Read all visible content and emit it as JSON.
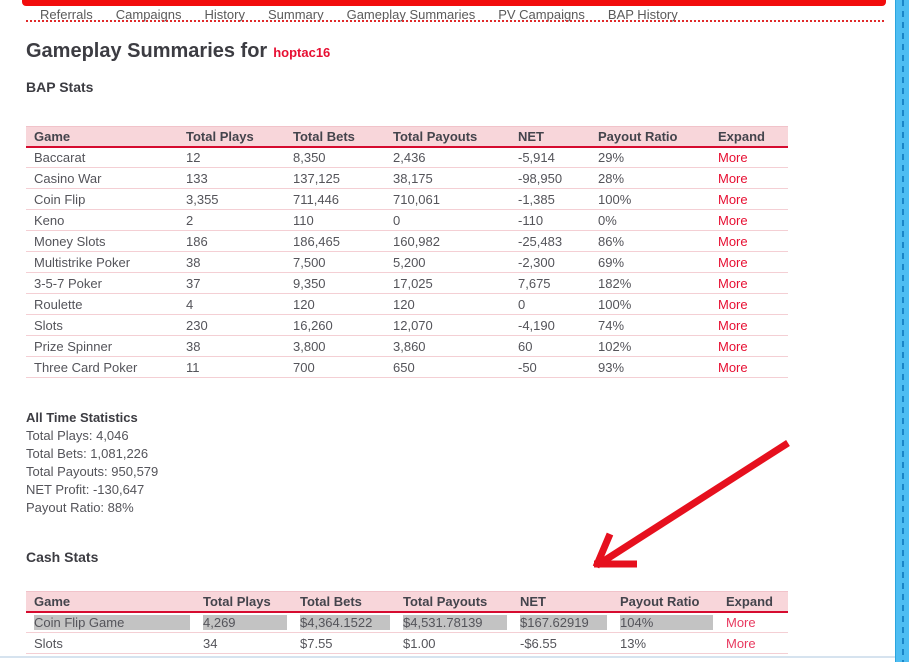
{
  "nav": {
    "items": [
      "Referrals",
      "Campaigns",
      "History",
      "Summary",
      "Gameplay Summaries",
      "PV Campaigns",
      "BAP History"
    ]
  },
  "page": {
    "title": "Gameplay Summaries for",
    "username": "hoptac16"
  },
  "bap": {
    "heading": "BAP Stats",
    "table": {
      "headers": [
        "Game",
        "Total Plays",
        "Total Bets",
        "Total Payouts",
        "NET",
        "Payout Ratio",
        "Expand"
      ],
      "rows": [
        {
          "cells": [
            "Baccarat",
            "12",
            "8,350",
            "2,436",
            "-5,914",
            "29%"
          ],
          "expand": "More"
        },
        {
          "cells": [
            "Casino War",
            "133",
            "137,125",
            "38,175",
            "-98,950",
            "28%"
          ],
          "expand": "More"
        },
        {
          "cells": [
            "Coin Flip",
            "3,355",
            "711,446",
            "710,061",
            "-1,385",
            "100%"
          ],
          "expand": "More"
        },
        {
          "cells": [
            "Keno",
            "2",
            "110",
            "0",
            "-110",
            "0%"
          ],
          "expand": "More"
        },
        {
          "cells": [
            "Money Slots",
            "186",
            "186,465",
            "160,982",
            "-25,483",
            "86%"
          ],
          "expand": "More"
        },
        {
          "cells": [
            "Multistrike Poker",
            "38",
            "7,500",
            "5,200",
            "-2,300",
            "69%"
          ],
          "expand": "More"
        },
        {
          "cells": [
            "3-5-7 Poker",
            "37",
            "9,350",
            "17,025",
            "7,675",
            "182%"
          ],
          "expand": "More"
        },
        {
          "cells": [
            "Roulette",
            "4",
            "120",
            "120",
            "0",
            "100%"
          ],
          "expand": "More"
        },
        {
          "cells": [
            "Slots",
            "230",
            "16,260",
            "12,070",
            "-4,190",
            "74%"
          ],
          "expand": "More"
        },
        {
          "cells": [
            "Prize Spinner",
            "38",
            "3,800",
            "3,860",
            "60",
            "102%"
          ],
          "expand": "More"
        },
        {
          "cells": [
            "Three Card Poker",
            "11",
            "700",
            "650",
            "-50",
            "93%"
          ],
          "expand": "More"
        }
      ]
    }
  },
  "all_time": {
    "heading": "All Time Statistics",
    "lines": [
      "Total Plays: 4,046",
      "Total Bets: 1,081,226",
      "Total Payouts: 950,579",
      "NET Profit: -130,647",
      "Payout Ratio: 88%"
    ]
  },
  "cash": {
    "heading": "Cash Stats",
    "table": {
      "headers": [
        "Game",
        "Total Plays",
        "Total Bets",
        "Total Payouts",
        "NET",
        "Payout Ratio",
        "Expand"
      ],
      "rows": [
        {
          "cells": [
            "Coin Flip Game",
            "4,269",
            "$4,364.1522",
            "$4,531.78139",
            "$167.62919",
            "104%"
          ],
          "expand": "More",
          "selected": true
        },
        {
          "cells": [
            "Slots",
            "34",
            "$7.55",
            "$1.00",
            "-$6.55",
            "13%"
          ],
          "expand": "More"
        }
      ]
    }
  },
  "colors": {
    "accent_red": "#e70f32",
    "topbar_red": "#f20d0d",
    "header_pink": "#f8d6da",
    "header_border_red": "#d60b2f",
    "row_border_pink": "#f4cfd4",
    "selection_gray": "#c3c3c3",
    "arrow_red": "#e6101e",
    "side_strip_blue": "#4ebdf2",
    "cash_more_pink": "#e8395f"
  }
}
